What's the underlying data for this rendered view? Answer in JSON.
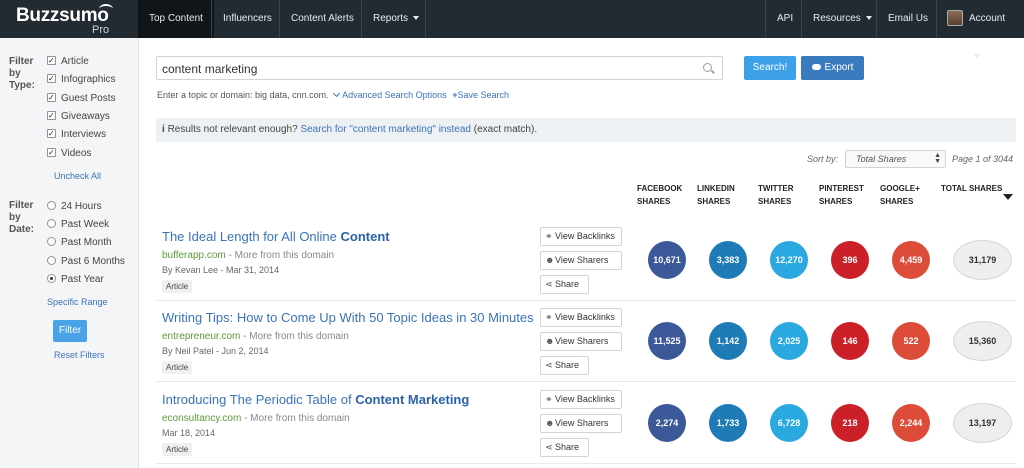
{
  "brand": {
    "name": "Buzzsumo",
    "tier": "Pro"
  },
  "nav": {
    "left": [
      {
        "label": "Top Content",
        "active": true
      },
      {
        "label": "Influencers"
      },
      {
        "label": "Content Alerts"
      },
      {
        "label": "Reports"
      }
    ],
    "right": [
      {
        "label": "API"
      },
      {
        "label": "Resources"
      },
      {
        "label": "Email Us"
      },
      {
        "label": "Account"
      }
    ]
  },
  "sidebar": {
    "type_heading": "Filter by Type:",
    "types": [
      {
        "label": "Article",
        "checked": true
      },
      {
        "label": "Infographics",
        "checked": true
      },
      {
        "label": "Guest Posts",
        "checked": true
      },
      {
        "label": "Giveaways",
        "checked": true
      },
      {
        "label": "Interviews",
        "checked": true
      },
      {
        "label": "Videos",
        "checked": true
      }
    ],
    "uncheck_all": "Uncheck All",
    "date_heading": "Filter by Date:",
    "dates": [
      {
        "label": "24 Hours",
        "selected": false
      },
      {
        "label": "Past Week",
        "selected": false
      },
      {
        "label": "Past Month",
        "selected": false
      },
      {
        "label": "Past 6 Months",
        "selected": false
      },
      {
        "label": "Past Year",
        "selected": true
      }
    ],
    "specific_range": "Specific Range",
    "filter_button": "Filter",
    "reset": "Reset Filters"
  },
  "search": {
    "value": "content marketing",
    "search_button": "Search!",
    "export_button": "Export",
    "hint": "Enter a topic or domain: big data, cnn.com.",
    "advanced": "Advanced Search Options",
    "save": "Save Search"
  },
  "notice": {
    "icon": "i",
    "lead": "Results not relevant enough?",
    "link": "Search for \"content marketing\" instead",
    "tail": "(exact match)."
  },
  "sort": {
    "label": "Sort by:",
    "value": "Total Shares",
    "page": "Page 1 of 3044"
  },
  "columns": [
    {
      "l1": "FACEBOOK",
      "l2": "SHARES"
    },
    {
      "l1": "LINKEDIN",
      "l2": "SHARES"
    },
    {
      "l1": "TWITTER",
      "l2": "SHARES"
    },
    {
      "l1": "PINTEREST",
      "l2": "SHARES"
    },
    {
      "l1": "GOOGLE+",
      "l2": "SHARES"
    },
    {
      "l1": "TOTAL SHARES",
      "l2": ""
    }
  ],
  "actions": {
    "backlinks": "View Backlinks",
    "sharers": "View Sharers",
    "share": "Share"
  },
  "colors": {
    "facebook": "#3b5999",
    "linkedin": "#1f7bb6",
    "twitter": "#2aa9e0",
    "pinterest": "#cb2027",
    "google": "#dd4b39"
  },
  "results": [
    {
      "title_plain": "The Ideal Length for All Online ",
      "title_bold": "Content",
      "domain": "bufferapp.com",
      "more": " - More from this domain",
      "meta": "By Kevan Lee - Mar 31, 2014",
      "tag": "Article",
      "facebook": "10,671",
      "linkedin": "3,383",
      "twitter": "12,270",
      "pinterest": "396",
      "google": "4,459",
      "total": "31,179"
    },
    {
      "title_plain": "Writing Tips: How to Come Up With 50 Topic Ideas in 30 Minutes",
      "title_bold": "",
      "domain": "entrepreneur.com",
      "more": " - More from this domain",
      "meta": "By Neil Patel - Jun 2, 2014",
      "tag": "Article",
      "facebook": "11,525",
      "linkedin": "1,142",
      "twitter": "2,025",
      "pinterest": "146",
      "google": "522",
      "total": "15,360"
    },
    {
      "title_plain": "Introducing The Periodic Table of ",
      "title_bold": "Content Marketing",
      "domain": "econsultancy.com",
      "more": " - More from this domain",
      "meta": "Mar 18, 2014",
      "tag": "Article",
      "facebook": "2,274",
      "linkedin": "1,733",
      "twitter": "6,728",
      "pinterest": "218",
      "google": "2,244",
      "total": "13,197"
    }
  ]
}
